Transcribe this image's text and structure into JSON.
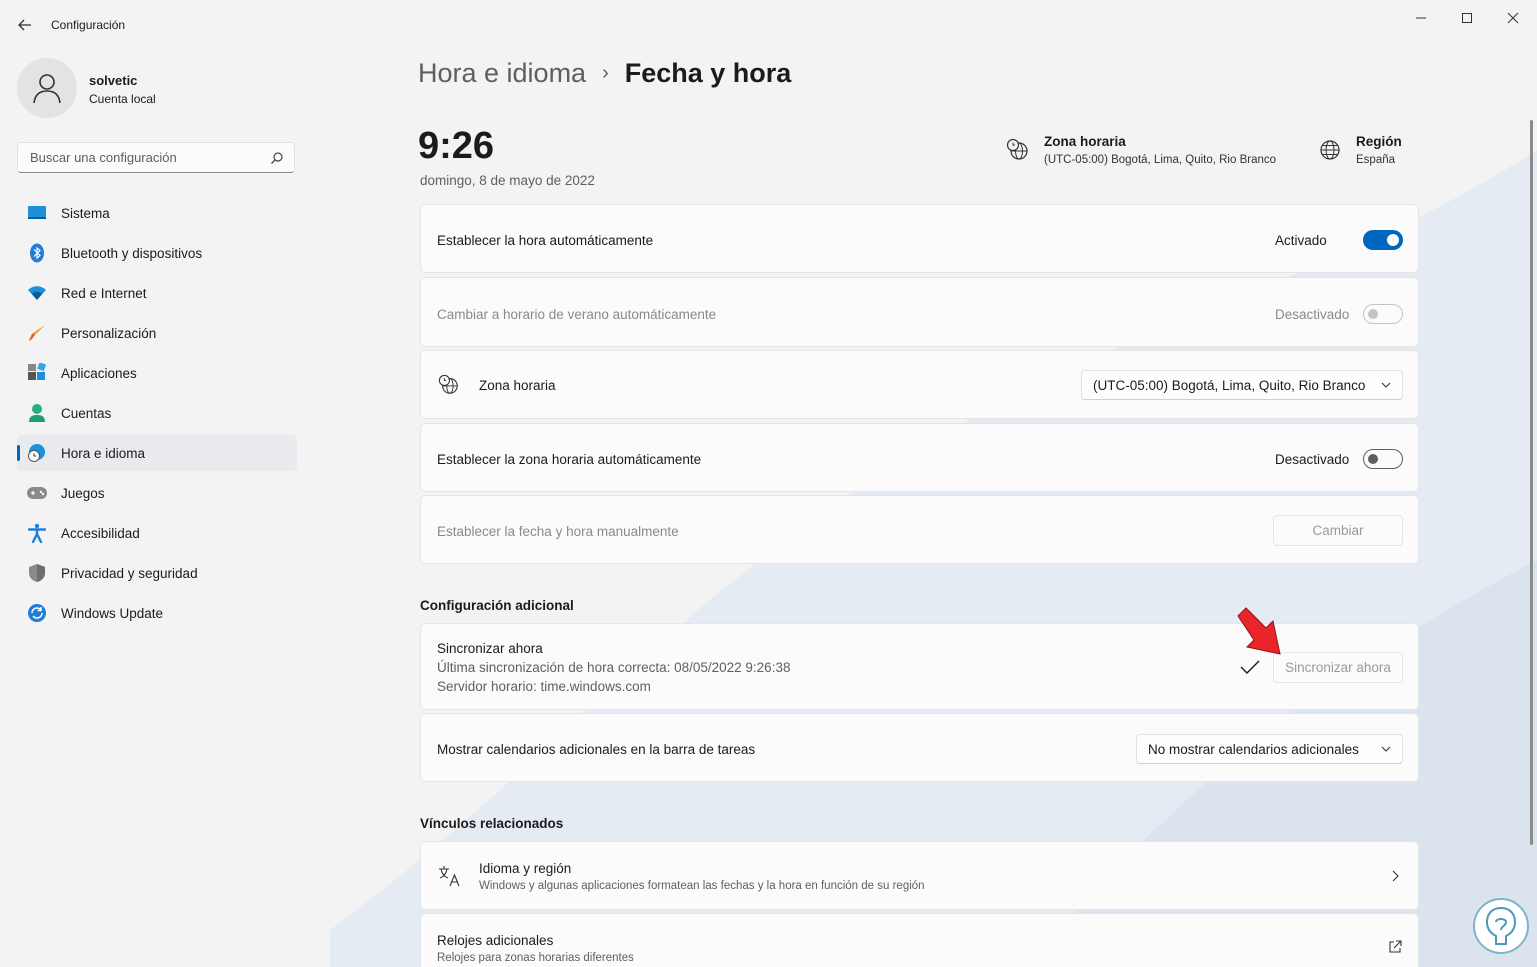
{
  "window": {
    "app_title": "Configuración",
    "minimize_icon": "minimize-icon",
    "maximize_icon": "maximize-icon",
    "close_icon": "close-icon"
  },
  "profile": {
    "name": "solvetic",
    "account_type": "Cuenta local"
  },
  "search": {
    "placeholder": "Buscar una configuración"
  },
  "sidebar": {
    "items": [
      {
        "label": "Sistema",
        "icon": "monitor-icon",
        "active": false
      },
      {
        "label": "Bluetooth y dispositivos",
        "icon": "bluetooth-icon",
        "active": false
      },
      {
        "label": "Red e Internet",
        "icon": "wifi-icon",
        "active": false
      },
      {
        "label": "Personalización",
        "icon": "brush-icon",
        "active": false
      },
      {
        "label": "Aplicaciones",
        "icon": "apps-icon",
        "active": false
      },
      {
        "label": "Cuentas",
        "icon": "person-icon",
        "active": false
      },
      {
        "label": "Hora e idioma",
        "icon": "globe-clock-icon",
        "active": true
      },
      {
        "label": "Juegos",
        "icon": "gamepad-icon",
        "active": false
      },
      {
        "label": "Accesibilidad",
        "icon": "accessibility-icon",
        "active": false
      },
      {
        "label": "Privacidad y seguridad",
        "icon": "shield-icon",
        "active": false
      },
      {
        "label": "Windows Update",
        "icon": "update-icon",
        "active": false
      }
    ]
  },
  "breadcrumb": {
    "parent": "Hora e idioma",
    "separator": "›",
    "current": "Fecha y hora"
  },
  "clock": {
    "time": "9:26",
    "date": "domingo, 8 de mayo de 2022"
  },
  "header_info": {
    "timezone_title": "Zona horaria",
    "timezone_value": "(UTC-05:00) Bogotá, Lima, Quito, Rio Branco",
    "region_title": "Región",
    "region_value": "España"
  },
  "settings": {
    "auto_time": {
      "label": "Establecer la hora automáticamente",
      "state": "Activado",
      "on": true
    },
    "dst": {
      "label": "Cambiar a horario de verano automáticamente",
      "state": "Desactivado",
      "on": false,
      "disabled": true
    },
    "timezone": {
      "label": "Zona horaria",
      "value": "(UTC-05:00) Bogotá, Lima, Quito, Rio Branco"
    },
    "auto_timezone": {
      "label": "Establecer la zona horaria automáticamente",
      "state": "Desactivado",
      "on": false
    },
    "manual": {
      "label": "Establecer la fecha y hora manualmente",
      "button": "Cambiar"
    }
  },
  "additional": {
    "title": "Configuración adicional",
    "sync": {
      "title": "Sincronizar ahora",
      "last_sync": "Última sincronización de hora correcta: 08/05/2022 9:26:38",
      "server": "Servidor horario: time.windows.com",
      "button": "Sincronizar ahora"
    },
    "calendars": {
      "label": "Mostrar calendarios adicionales en la barra de tareas",
      "value": "No mostrar calendarios adicionales"
    }
  },
  "related": {
    "title": "Vínculos relacionados",
    "language_region": {
      "title": "Idioma y región",
      "subtitle": "Windows y algunas aplicaciones formatean las fechas y la hora en función de su región"
    },
    "additional_clocks": {
      "title": "Relojes adicionales",
      "subtitle": "Relojes para zonas horarias diferentes"
    }
  },
  "colors": {
    "accent": "#0067c0",
    "annotation_arrow": "#e8262a"
  }
}
